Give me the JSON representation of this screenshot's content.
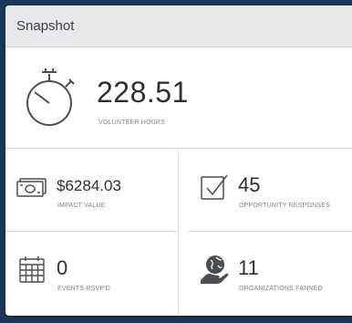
{
  "card": {
    "title": "Snapshot"
  },
  "hero": {
    "value": "228.51",
    "label": "VOLUNTEER HOURS",
    "icon": "stopwatch-icon"
  },
  "stats": [
    {
      "value": "$6284.03",
      "label": "IMPACT VALUE",
      "icon": "money-icon"
    },
    {
      "value": "45",
      "label": "OPPORTUNITY RESPONSES",
      "icon": "checkbox-icon"
    },
    {
      "value": "0",
      "label": "EVENTS RSVP'D",
      "icon": "calendar-icon"
    },
    {
      "value": "11",
      "label": "ORGANIZATIONS FANNED",
      "icon": "globe-hand-icon"
    }
  ],
  "colors": {
    "background": "#1d3556",
    "header": "#e7e8ea",
    "text": "#2c2f34",
    "muted": "#7d8188"
  }
}
